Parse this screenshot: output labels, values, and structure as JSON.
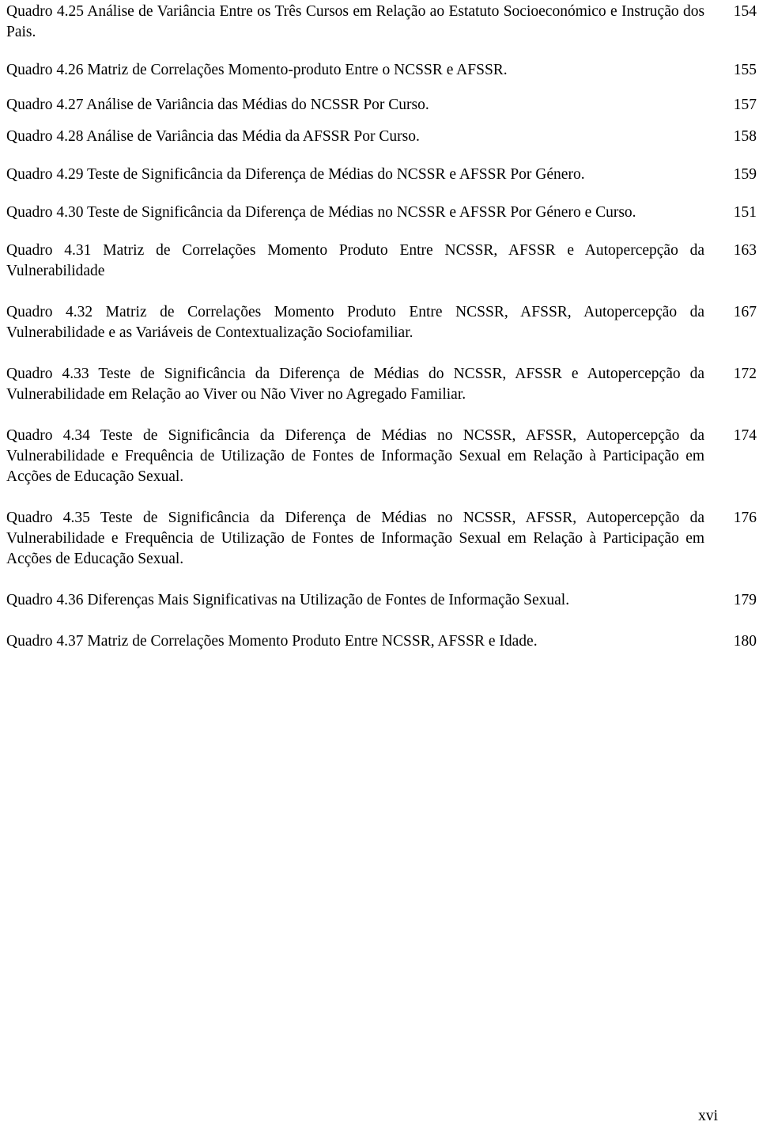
{
  "document": {
    "type": "list-of-tables",
    "folio": "xvi"
  },
  "entries": [
    {
      "text": "Quadro 4.25 Análise de Variância Entre os Três Cursos em Relação ao Estatuto Socioeconómico e Instrução dos Pais.",
      "page": "154",
      "lines": 2
    },
    {
      "text": "Quadro 4.26 Matriz de Correlações Momento-produto Entre o NCSSR e AFSSR.",
      "page": "155",
      "lines": 1
    },
    {
      "text": "Quadro 4.27 Análise de Variância das Médias do NCSSR Por Curso.",
      "page": "157",
      "lines": 1
    },
    {
      "text": "Quadro 4.28 Análise de Variância das Média da AFSSR Por Curso.",
      "page": "158",
      "lines": 1
    },
    {
      "text": "Quadro 4.29 Teste de Significância da Diferença de Médias do NCSSR e AFSSR Por Género.",
      "page": "159",
      "lines": 2
    },
    {
      "text": "Quadro 4.30 Teste de Significância da Diferença de Médias no NCSSR e AFSSR Por Género e Curso.",
      "page": "151",
      "lines": 2
    },
    {
      "text": "Quadro 4.31 Matriz de Correlações Momento Produto Entre NCSSR, AFSSR e Autopercepção da Vulnerabilidade",
      "page": "163",
      "lines": 2
    },
    {
      "text": "Quadro 4.32 Matriz de Correlações Momento Produto Entre NCSSR, AFSSR, Autopercepção da Vulnerabilidade e as Variáveis de Contextualização Sociofamiliar.",
      "page": "167",
      "lines": 2
    },
    {
      "text": "Quadro 4.33 Teste de Significância da Diferença de Médias do NCSSR, AFSSR e Autopercepção da Vulnerabilidade em Relação ao Viver ou Não Viver no Agregado Familiar.",
      "page": "172",
      "lines": 3
    },
    {
      "text": "Quadro 4.34 Teste de Significância da Diferença de Médias no NCSSR, AFSSR, Autopercepção da Vulnerabilidade e Frequência de Utilização de Fontes de Informação Sexual em Relação à Participação em Acções de Educação Sexual.",
      "page": "174",
      "lines": 3
    },
    {
      "text": "Quadro 4.35 Teste de Significância da Diferença de Médias no NCSSR, AFSSR, Autopercepção da Vulnerabilidade e Frequência de Utilização de Fontes de Informação Sexual em Relação à Participação em Acções de Educação Sexual.",
      "page": "176",
      "lines": 3
    },
    {
      "text": "Quadro 4.36 Diferenças Mais Significativas na Utilização de Fontes de Informação Sexual.",
      "page": "179",
      "lines": 2
    },
    {
      "text": "Quadro 4.37 Matriz de Correlações Momento Produto Entre NCSSR, AFSSR e Idade.",
      "page": "180",
      "lines": 1
    }
  ]
}
